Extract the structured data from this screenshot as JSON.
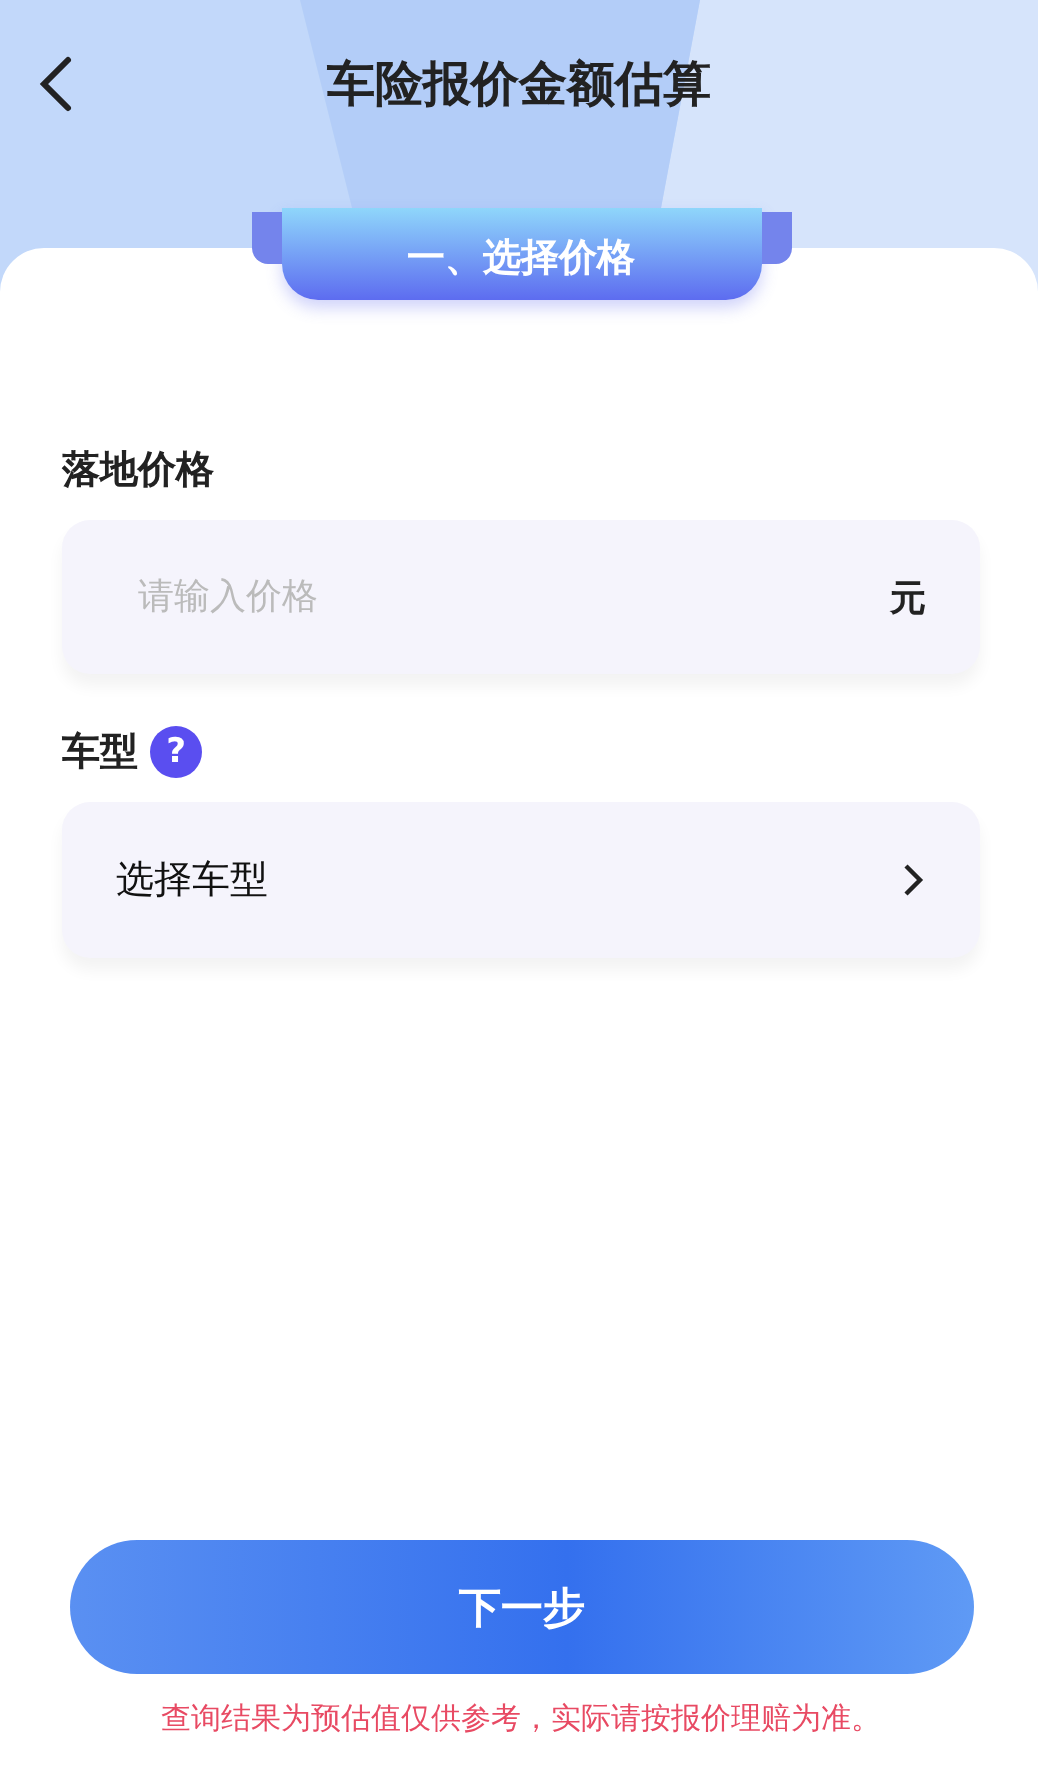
{
  "header": {
    "title": "车险报价金额估算"
  },
  "section": {
    "title": "一、选择价格"
  },
  "price_field": {
    "label": "落地价格",
    "placeholder": "请输入价格",
    "unit": "元"
  },
  "model_field": {
    "label": "车型",
    "help": "?",
    "value": "选择车型"
  },
  "next_button": {
    "label": "下一步"
  },
  "disclaimer": "查询结果为预估值仅供参考，实际请按报价理赔为准。"
}
